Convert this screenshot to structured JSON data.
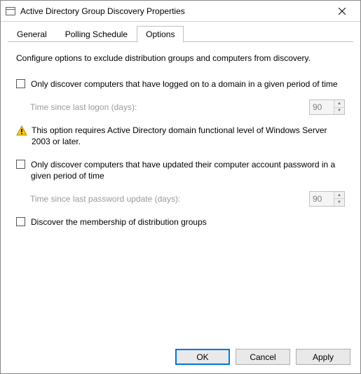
{
  "titlebar": {
    "title": "Active Directory Group Discovery Properties"
  },
  "tabs": {
    "general": "General",
    "polling": "Polling Schedule",
    "options": "Options"
  },
  "content": {
    "intro": "Configure options to exclude distribution groups and computers from discovery.",
    "opt_logon": "Only discover computers that have logged on to a domain in a given period of time",
    "sub_logon_label": "Time since last logon (days):",
    "sub_logon_value": "90",
    "warn": "This option requires Active Directory domain functional level of Windows Server 2003 or later.",
    "opt_pwd": "Only discover computers that have updated their computer account password in a given period of time",
    "sub_pwd_label": "Time since last password update (days):",
    "sub_pwd_value": "90",
    "opt_dist": "Discover the membership of distribution groups"
  },
  "footer": {
    "ok": "OK",
    "cancel": "Cancel",
    "apply": "Apply"
  }
}
